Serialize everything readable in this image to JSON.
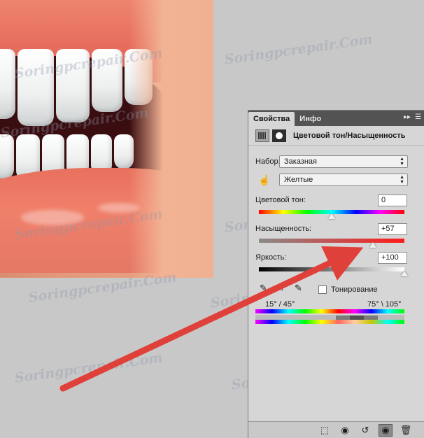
{
  "panel": {
    "tabs": [
      {
        "label": "Свойства",
        "active": true
      },
      {
        "label": "Инфо",
        "active": false
      }
    ],
    "menu_glyph": "▸▸",
    "header_title": "Цветовой тон/Насыщенность",
    "preset_label": "Набор:",
    "preset_value": "Заказная",
    "channel_value": "Желтые",
    "hue": {
      "label": "Цветовой тон:",
      "value": "0",
      "level": 0
    },
    "saturation": {
      "label": "Насыщенность:",
      "value": "+57",
      "level": 57
    },
    "lightness": {
      "label": "Яркость:",
      "value": "+100",
      "level": 100
    },
    "colorize_label": "Тонирование",
    "range_left": "15° / 45°",
    "range_right": "75° \\ 105°"
  },
  "bottom_icons": [
    "clip-to-layer-icon",
    "view-previous-icon",
    "reset-icon",
    "visibility-icon",
    "trash-icon"
  ],
  "watermark_text": "Soringpcrepair.Com",
  "colors": {
    "panel_bg": "#d6d6d6",
    "tab_bar": "#535353",
    "arrow": "#e0403a",
    "background": "#c8c8c8"
  }
}
